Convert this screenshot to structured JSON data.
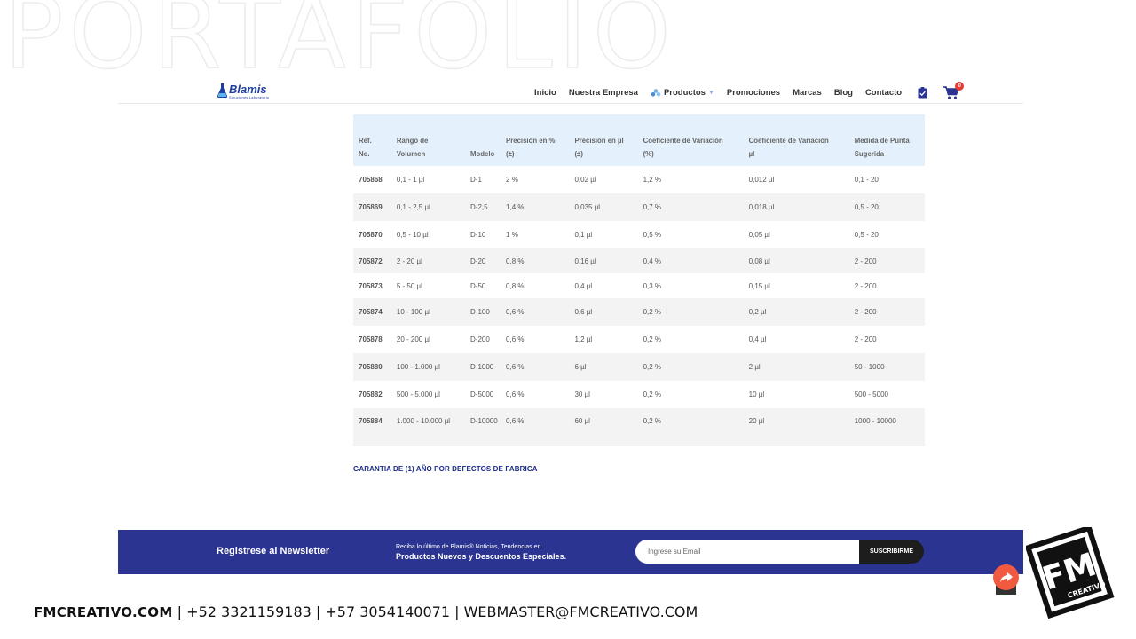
{
  "background_title": "PORTAFOLIO",
  "site": {
    "logo": {
      "name": "Blamis",
      "tagline": "Soluciones Laboratorio"
    },
    "nav": [
      {
        "label": "Inicio"
      },
      {
        "label": "Nuestra Empresa"
      },
      {
        "label": "Productos"
      },
      {
        "label": "Promociones"
      },
      {
        "label": "Marcas"
      },
      {
        "label": "Blog"
      },
      {
        "label": "Contacto"
      }
    ],
    "cart_count": "0",
    "table": {
      "headers": [
        [
          "Ref.",
          "No."
        ],
        [
          "Rango de",
          "Volumen"
        ],
        [
          "",
          "Modelo"
        ],
        [
          "Precisión en %",
          "(±)"
        ],
        [
          "Precisión en µl",
          "(±)"
        ],
        [
          "Coeficiente de Variación",
          "(%)"
        ],
        [
          "Coeficiente de Variación",
          "µl"
        ],
        [
          "Medida de Punta",
          "Sugerida"
        ]
      ],
      "rows": [
        [
          "705868",
          "0,1 - 1 µl",
          "D-1",
          "2 %",
          "0,02 µl",
          "1,2 %",
          "0,012 µl",
          "0,1 - 20"
        ],
        [
          "705869",
          "0,1 - 2,5 µl",
          "D-2,5",
          "1,4 %",
          "0,035 µl",
          "0,7 %",
          "0,018 µl",
          "0,5 - 20"
        ],
        [
          "705870",
          "0,5 - 10 µl",
          "D-10",
          "1 %",
          "0,1 µl",
          "0,5 %",
          "0,05 µl",
          "0,5 - 20"
        ],
        [
          "705872",
          "2 - 20 µl",
          "D-20",
          "0,8 %",
          "0,16 µl",
          "0,4 %",
          "0,08 µl",
          "2 - 200"
        ],
        [
          "705873",
          "5 - 50 µl",
          "D-50",
          "0,8 %",
          "0,4 µl",
          "0,3 %",
          "0,15 µl",
          "2 - 200"
        ],
        [
          "705874",
          "10 - 100 µl",
          "D-100",
          "0,6 %",
          "0,6 µl",
          "0,2 %",
          "0,2 µl",
          "2 - 200"
        ],
        [
          "705878",
          "20 - 200 µl",
          "D-200",
          "0,6 %",
          "1,2 µl",
          "0,2 %",
          "0,4 µl",
          "2 - 200"
        ],
        [
          "705880",
          "100 - 1.000 µl",
          "D-1000",
          "0,6 %",
          "6 µl",
          "0,2 %",
          "2 µl",
          "50 - 1000"
        ],
        [
          "705882",
          "500 - 5.000 µl",
          "D-5000",
          "0,6 %",
          "30 µl",
          "0,2 %",
          "10 µl",
          "500 - 5000"
        ],
        [
          "705884",
          "1.000 - 10.000 µl",
          "D-10000",
          "0,6 %",
          "60 µl",
          "0,2 %",
          "20 µl",
          "1000 - 10000"
        ]
      ]
    },
    "warranty": "GARANTIA DE (1) AÑO POR DEFECTOS DE FABRICA",
    "newsletter": {
      "title": "Registrese al Newsletter",
      "line1": "Reciba lo último de Blamis® Noticias, Tendencias en",
      "line2": "Productos Nuevos y Descuentos Especiales.",
      "placeholder": "Ingrese su Email",
      "button": "SUSCRIBIRME"
    }
  },
  "footer": {
    "brand": "FMCREATIVO.COM",
    "contact": " | +52 3321159183 | +57 3054140071 |  WEBMASTER@FMCREATIVO.COM"
  },
  "fm_logo": {
    "letters": "FM",
    "word": "CREATIVO"
  },
  "icons": [
    "flask-icon",
    "products-icon",
    "chevron-down-icon",
    "clipboard-check-icon",
    "cart-icon",
    "share-icon"
  ],
  "colors": {
    "brand_blue": "#2b3591",
    "header_row": "#e4f0fb",
    "share": "#f15a40"
  }
}
